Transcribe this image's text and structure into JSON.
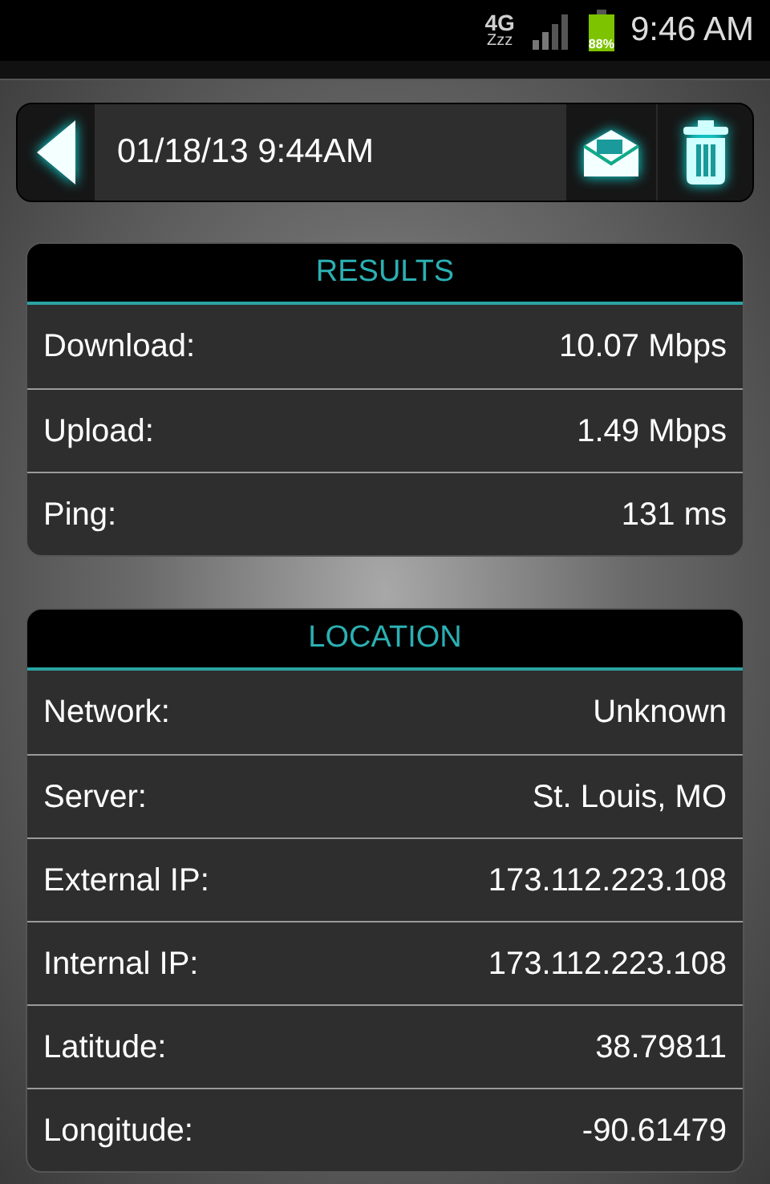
{
  "status_bar": {
    "network": "4G",
    "sleep": "Zzz",
    "battery": "88%",
    "time": "9:46 AM"
  },
  "header": {
    "title": "01/18/13 9:44AM"
  },
  "sections": [
    {
      "title": "RESULTS",
      "rows": [
        {
          "label": "Download:",
          "value": "10.07 Mbps"
        },
        {
          "label": "Upload:",
          "value": "1.49 Mbps"
        },
        {
          "label": "Ping:",
          "value": "131 ms"
        }
      ]
    },
    {
      "title": "LOCATION",
      "rows": [
        {
          "label": "Network:",
          "value": "Unknown"
        },
        {
          "label": "Server:",
          "value": "St. Louis, MO"
        },
        {
          "label": "External IP:",
          "value": "173.112.223.108"
        },
        {
          "label": "Internal IP:",
          "value": "173.112.223.108"
        },
        {
          "label": "Latitude:",
          "value": "38.79811"
        },
        {
          "label": "Longitude:",
          "value": "-90.61479"
        }
      ]
    }
  ]
}
